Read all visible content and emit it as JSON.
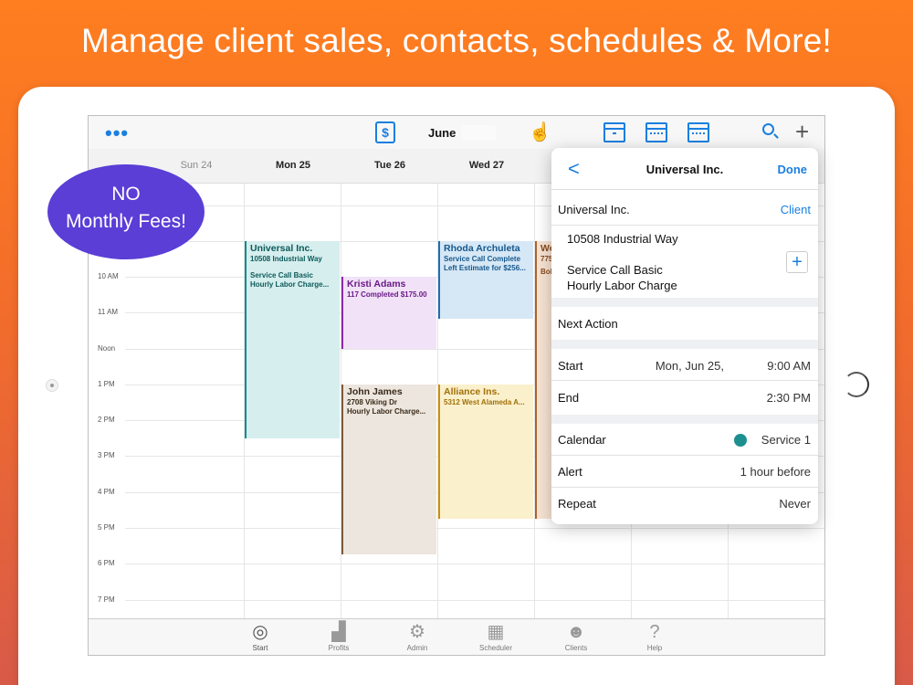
{
  "promo": {
    "title": "Manage client sales, contacts, schedules & More!",
    "badge_line1": "NO",
    "badge_line2": "Monthly Fees!"
  },
  "toolbar": {
    "month": "June",
    "more_icon": "ellipsis-icon",
    "dollar_icon": "dollar-document-icon",
    "hand_icon": "hand-pointer-icon"
  },
  "days": [
    "Sun 24",
    "Mon 25",
    "Tue 26",
    "Wed 27"
  ],
  "hours": [
    "10 AM",
    "11 AM",
    "Noon",
    "1 PM",
    "2 PM",
    "3 PM",
    "4 PM",
    "5 PM",
    "6 PM",
    "7 PM"
  ],
  "events": [
    {
      "title": "Universal Inc.",
      "line1": "10508 Industrial Way",
      "line2": "",
      "line3": "Service Call Basic",
      "line4": "Hourly Labor Charge...",
      "color": "#0f8a8a",
      "bg": "#d6eeee"
    },
    {
      "title": "Kristi Adams",
      "line1": "117 Completed $175.00",
      "color": "#8a2aa8",
      "bg": "#f1e2f7"
    },
    {
      "title": "Rhoda Archuleta",
      "line1": "Service Call Complete",
      "line2": "Left Estimate for $256...",
      "color": "#1e6fb0",
      "bg": "#d6e7f5"
    },
    {
      "title": "We",
      "line1": "775",
      "line2": "Bob",
      "color": "#b0622a",
      "bg": "#f7e3d2"
    },
    {
      "title": "John James",
      "line1": "2708 Viking Dr",
      "line2": "Hourly Labor Charge...",
      "color": "#5a3a1e",
      "bg": "#ece6df"
    },
    {
      "title": "Alliance Ins.",
      "line1": "5312 West Alameda A...",
      "color": "#c89010",
      "bg": "#fbf0cc"
    }
  ],
  "popover": {
    "back": "<",
    "title": "Universal Inc.",
    "done": "Done",
    "client_name": "Universal Inc.",
    "client_link": "Client",
    "address": "10508 Industrial Way",
    "service1": "Service Call Basic",
    "service2": "Hourly Labor Charge",
    "next_action": "Next Action",
    "start_label": "Start",
    "start_date": "Mon, Jun 25,",
    "start_time": "9:00 AM",
    "end_label": "End",
    "end_time": "2:30 PM",
    "calendar_label": "Calendar",
    "calendar_value": "Service 1",
    "calendar_color": "#1e8f8f",
    "alert_label": "Alert",
    "alert_value": "1 hour before",
    "repeat_label": "Repeat",
    "repeat_value": "Never"
  },
  "tabs": [
    {
      "label": "Start",
      "icon": "target-icon"
    },
    {
      "label": "Profits",
      "icon": "bar-chart-icon"
    },
    {
      "label": "Admin",
      "icon": "gear-icon"
    },
    {
      "label": "Scheduler",
      "icon": "calendar-icon"
    },
    {
      "label": "Clients",
      "icon": "people-icon"
    },
    {
      "label": "Help",
      "icon": "help-icon"
    }
  ]
}
